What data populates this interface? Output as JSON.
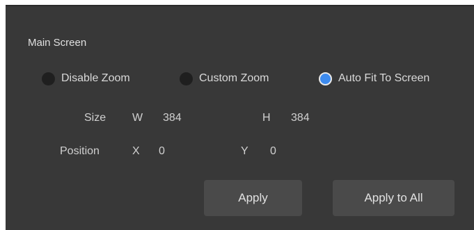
{
  "section": {
    "title": "Main Screen"
  },
  "zoom_options": [
    {
      "label": "Disable Zoom",
      "checked": false
    },
    {
      "label": "Custom Zoom",
      "checked": false
    },
    {
      "label": "Auto Fit To Screen",
      "checked": true
    }
  ],
  "size": {
    "label": "Size",
    "w_label": "W",
    "w_value": "384",
    "h_label": "H",
    "h_value": "384"
  },
  "position": {
    "label": "Position",
    "x_label": "X",
    "x_value": "0",
    "y_label": "Y",
    "y_value": "0"
  },
  "buttons": {
    "apply": "Apply",
    "apply_all": "Apply to All"
  },
  "colors": {
    "panel_bg": "#383838",
    "button_bg": "#4a4a4a",
    "radio_checked": "#3d8bef",
    "radio_unchecked": "#1f1f1f"
  }
}
